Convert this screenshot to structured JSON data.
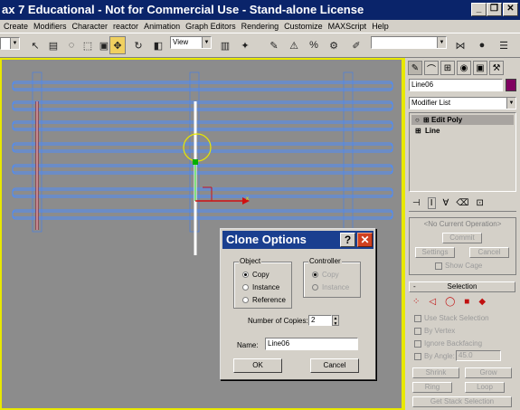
{
  "title": "ax 7  Educational - Not for Commercial Use - Stand-alone License",
  "menu": [
    "Create",
    "Modifiers",
    "Character",
    "reactor",
    "Animation",
    "Graph Editors",
    "Rendering",
    "Customize",
    "MAXScript",
    "Help"
  ],
  "toolbar": {
    "view_combo": "View"
  },
  "panel": {
    "object_name": "Line06",
    "modifier_list": "Modifier List",
    "stack": [
      "Edit Poly",
      "Line"
    ],
    "no_op": "<No Current Operation>",
    "commit": "Commit",
    "settings": "Settings",
    "cancel": "Cancel",
    "show_cage": "Show Cage",
    "selection": "Selection",
    "use_stack": "Use Stack Selection",
    "by_vertex": "By Vertex",
    "ignore_backfacing": "Ignore Backfacing",
    "by_angle": "By Angle:",
    "angle_value": "45.0",
    "shrink": "Shrink",
    "grow": "Grow",
    "ring": "Ring",
    "loop": "Loop",
    "get_stack": "Get Stack Selection",
    "rollout_minus": "-"
  },
  "dialog": {
    "title": "Clone Options",
    "object_group": "Object",
    "controller_group": "Controller",
    "object_options": [
      "Copy",
      "Instance",
      "Reference"
    ],
    "controller_options": [
      "Copy",
      "Instance"
    ],
    "copies_label": "Number of Copies:",
    "copies_value": "2",
    "name_label": "Name:",
    "name_value": "Line06",
    "ok": "OK",
    "cancel": "Cancel"
  }
}
